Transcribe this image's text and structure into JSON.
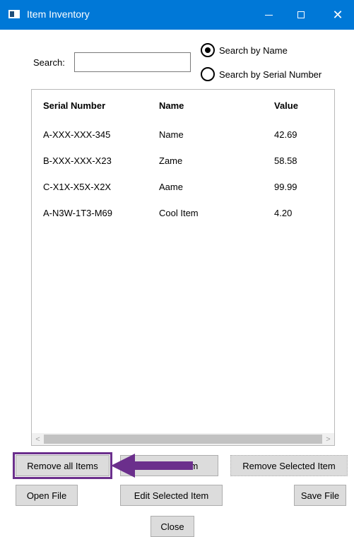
{
  "window": {
    "title": "Item Inventory"
  },
  "search": {
    "label": "Search:",
    "value": "",
    "placeholder": "",
    "options": [
      {
        "label": "Search by Name",
        "checked": true
      },
      {
        "label": "Search by Serial Number",
        "checked": false
      }
    ]
  },
  "table": {
    "columns": [
      "Serial Number",
      "Name",
      "Value"
    ],
    "rows": [
      [
        "A-XXX-XXX-345",
        "Name",
        "42.69"
      ],
      [
        "B-XXX-XXX-X23",
        "Zame",
        "58.58"
      ],
      [
        "C-X1X-X5X-X2X",
        "Aame",
        "99.99"
      ],
      [
        "A-N3W-1T3-M69",
        "Cool Item",
        "4.20"
      ]
    ]
  },
  "buttons": {
    "remove_all": "Remove all Items",
    "add_new": "Add New Item",
    "remove_selected": "Remove Selected Item",
    "open_file": "Open File",
    "edit_selected": "Edit Selected Item",
    "save_file": "Save File",
    "close": "Close"
  },
  "colors": {
    "titlebar": "#0078d7",
    "annotation": "#6b2f8c"
  }
}
